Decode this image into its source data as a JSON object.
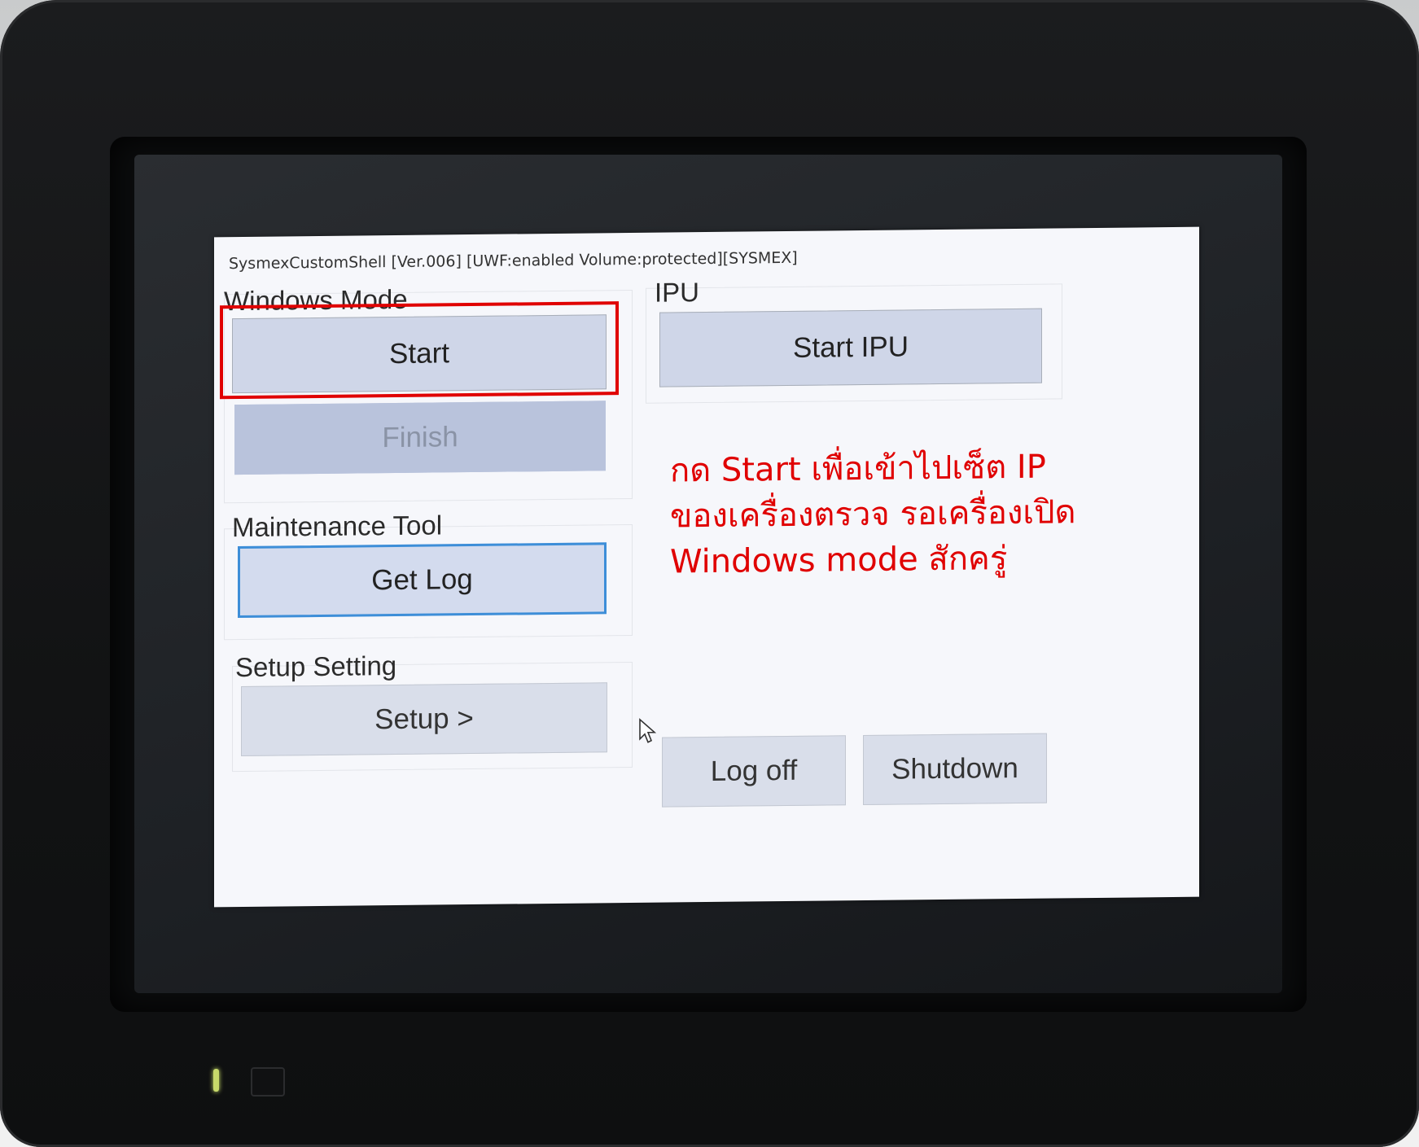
{
  "shell": {
    "title": "SysmexCustomShell [Ver.006] [UWF:enabled  Volume:protected][SYSMEX]"
  },
  "windows_mode": {
    "label": "Windows Mode",
    "start_label": "Start",
    "finish_label": "Finish"
  },
  "ipu": {
    "label": "IPU",
    "start_ipu_label": "Start IPU"
  },
  "maintenance": {
    "label": "Maintenance Tool",
    "get_log_label": "Get Log"
  },
  "setup": {
    "label": "Setup Setting",
    "setup_label": "Setup >"
  },
  "footer": {
    "log_off_label": "Log off",
    "shutdown_label": "Shutdown"
  },
  "annotation": {
    "line1": "กด Start เพื่อเข้าไปเซ็ต IP",
    "line2": "ของเครื่องตรวจ รอเครื่องเปิด",
    "line3": " Windows mode สักครู่",
    "color": "#e00000"
  },
  "icons": {
    "pointer": "mouse-pointer-icon"
  }
}
